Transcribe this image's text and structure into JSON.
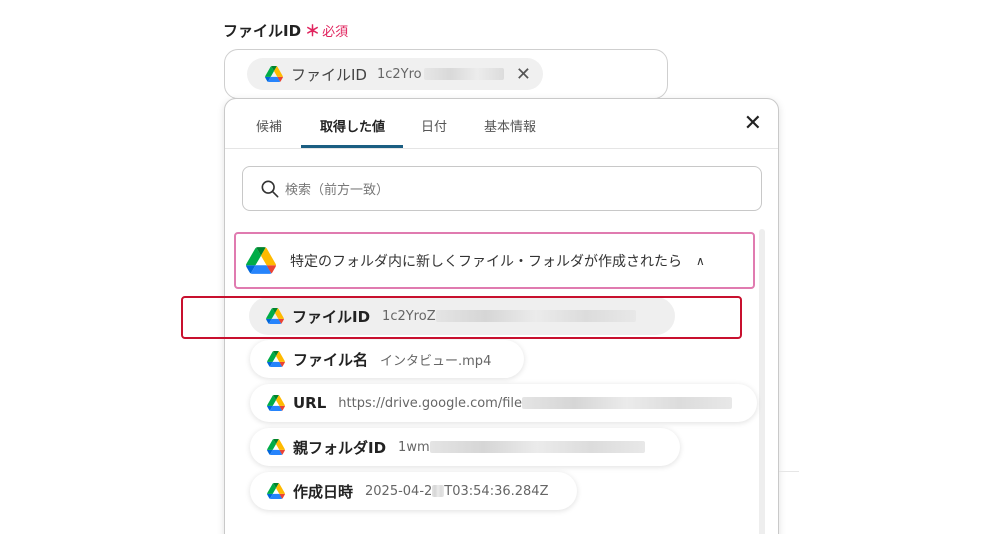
{
  "field": {
    "label": "ファイルID",
    "required_mark": "＊",
    "required_text": "必須"
  },
  "selected_chip": {
    "label": "ファイルID",
    "value": "1c2Yro",
    "icon": "google-drive-icon",
    "close": "✕"
  },
  "tabs": [
    {
      "label": "候補"
    },
    {
      "label": "取得した値",
      "active": true
    },
    {
      "label": "日付"
    },
    {
      "label": "基本情報"
    }
  ],
  "panel_close": "✕",
  "search": {
    "placeholder": "検索（前方一致）"
  },
  "group": {
    "title": "特定のフォルダ内に新しくファイル・フォルダが作成されたら",
    "chevron": "∧"
  },
  "items": [
    {
      "label": "ファイルID",
      "value": "1c2YroZ",
      "selected": true
    },
    {
      "label": "ファイル名",
      "value": "インタビュー.mp4"
    },
    {
      "label": "URL",
      "value": "https://drive.google.com/file"
    },
    {
      "label": "親フォルダID",
      "value": "1wm"
    },
    {
      "label": "作成日時",
      "value_prefix": "2025-04-2",
      "value_suffix": "T03:54:36.284Z"
    }
  ],
  "colors": {
    "required": "#e0245e",
    "tab_underline": "#1b5e82",
    "group_border": "#e07bb0",
    "highlight": "#c8102e"
  }
}
